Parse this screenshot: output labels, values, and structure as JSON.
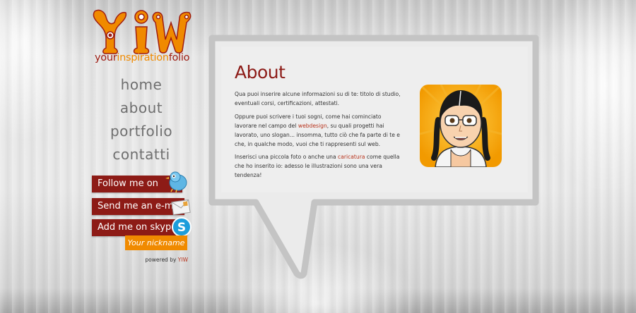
{
  "logo": {
    "mark_text": "YIW",
    "word_your": "your",
    "word_inspiration": "inspiration",
    "word_folio": "folio"
  },
  "nav": {
    "items": [
      {
        "label": "home"
      },
      {
        "label": "about"
      },
      {
        "label": "portfolio"
      },
      {
        "label": "contatti"
      }
    ]
  },
  "social": {
    "follow": "Follow me on",
    "email": "Send me an e-mail",
    "skype": "Add me on skype",
    "nickname": "Your nickname"
  },
  "footer": {
    "powered_prefix": "powered by ",
    "powered_brand": "YIW"
  },
  "about": {
    "title": "About",
    "p1": "Qua puoi inserire alcune informazioni su di te: titolo di studio, eventuali corsi, certificazioni, attestati.",
    "p2_a": "Oppure puoi scrivere i tuoi sogni, come hai cominciato lavorare nel campo del ",
    "p2_link": "webdesign",
    "p2_b": ", su quali progetti hai lavorato, uno slogan... insomma, tutto ciò che fa parte di te e che, in qualche modo, vuoi che ti rappresenti sul web.",
    "p3_a": "Inserisci una piccola foto o anche una ",
    "p3_link": "caricatura",
    "p3_b": " come quella che ho inserito io: adesso le illustrazioni sono una vera tendenza!"
  },
  "colors": {
    "accent_red": "#8c1a16",
    "accent_orange": "#f08a00",
    "link": "#b8331c",
    "nav_text": "#6f6f6f"
  }
}
